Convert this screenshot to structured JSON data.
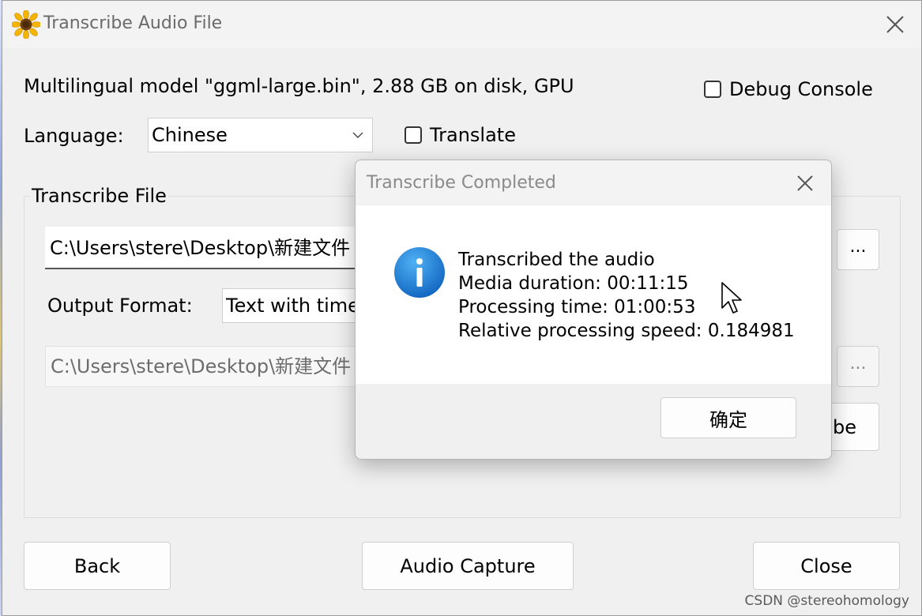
{
  "window": {
    "title": "Transcribe Audio File",
    "model_info": "Multilingual model \"ggml-large.bin\", 2.88 GB on disk, GPU",
    "debug_console_label": "Debug Console",
    "debug_console_checked": false,
    "language_label": "Language:",
    "language_value": "Chinese",
    "translate_label": "Translate",
    "translate_checked": false
  },
  "transcribe_group": {
    "title": "Transcribe File",
    "input_path": "C:\\Users\\stere\\Desktop\\新建文件",
    "browse_label": "...",
    "output_format_label": "Output Format:",
    "output_format_value": "Text with time",
    "output_path": "C:\\Users\\stere\\Desktop\\新建文件",
    "output_browse_label": "...",
    "transcribe_button_partial": "be"
  },
  "bottom_buttons": {
    "back": "Back",
    "audio_capture": "Audio Capture",
    "close": "Close"
  },
  "dialog": {
    "title": "Transcribe Completed",
    "lines": [
      "Transcribed the audio",
      "Media duration: 00:11:15",
      "Processing time: 01:00:53",
      "Relative processing speed: 0.184981"
    ],
    "ok_label": "确定"
  },
  "watermark": "CSDN @stereohomology",
  "icons": {
    "app": "sunflower-icon",
    "close": "close-icon",
    "info": "info-icon",
    "dropdown": "chevron-down-icon",
    "cursor": "mouse-cursor-icon"
  },
  "colors": {
    "window_bg": "#f0f0f0",
    "info_blue": "#1a73d1",
    "dialog_title_gray": "#8a8a8a"
  }
}
